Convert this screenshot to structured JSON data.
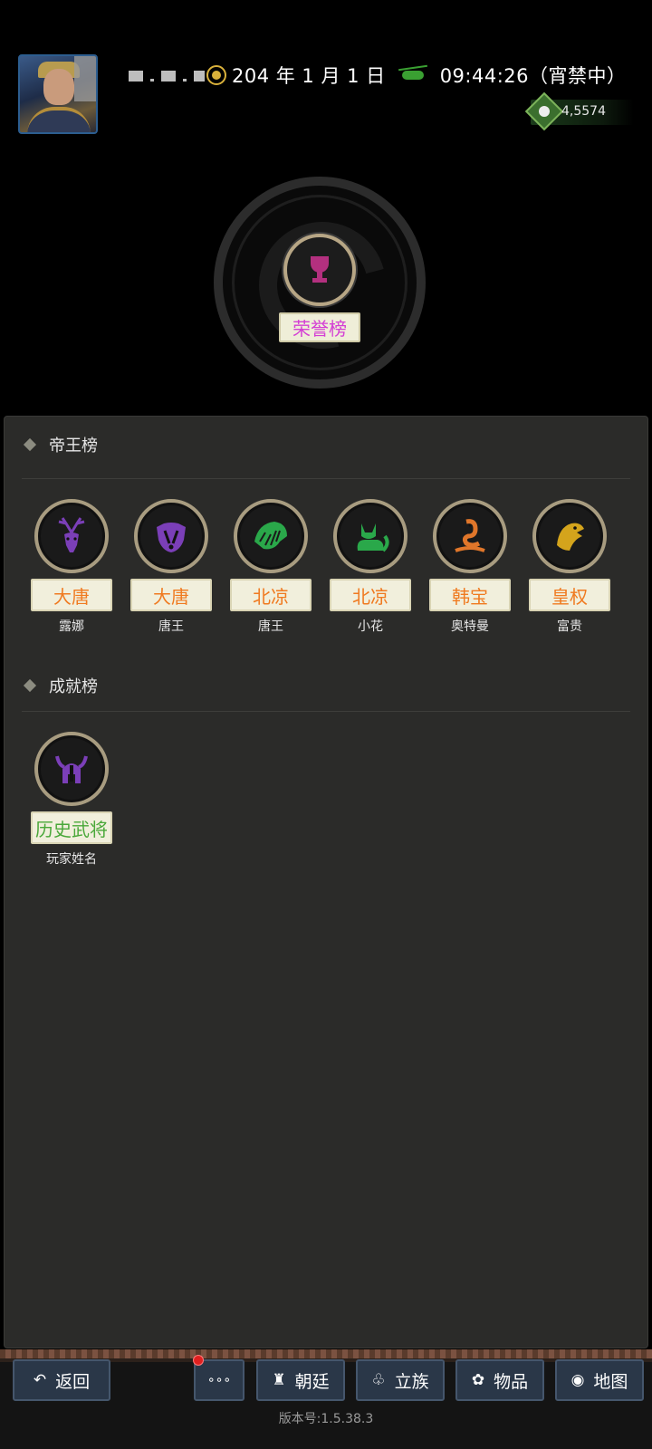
{
  "header": {
    "date": "204 年 1 月 1 日",
    "time": "09:44:26（宵禁中）",
    "currency": "4,5574"
  },
  "honor": {
    "label": "荣誉榜"
  },
  "emperor_rank": {
    "title": "帝王榜",
    "items": [
      {
        "tag": "大唐",
        "name": "露娜",
        "icon": "deer-icon",
        "icon_color": "#7b3fb8",
        "tag_color": "#f07a20"
      },
      {
        "tag": "大唐",
        "name": "唐王",
        "icon": "badger-icon",
        "icon_color": "#7b3fb8",
        "tag_color": "#f07a20"
      },
      {
        "tag": "北凉",
        "name": "唐王",
        "icon": "pangolin-icon",
        "icon_color": "#2aa84a",
        "tag_color": "#f07a20"
      },
      {
        "tag": "北凉",
        "name": "小花",
        "icon": "fox-icon",
        "icon_color": "#2aa84a",
        "tag_color": "#f07a20"
      },
      {
        "tag": "韩宝",
        "name": "奥特曼",
        "icon": "cobra-icon",
        "icon_color": "#e0762a",
        "tag_color": "#f07a20"
      },
      {
        "tag": "皇权",
        "name": "富贵",
        "icon": "eagle-icon",
        "icon_color": "#d4a41c",
        "tag_color": "#f07a20"
      }
    ]
  },
  "achievement_rank": {
    "title": "成就榜",
    "items": [
      {
        "tag": "历史武将",
        "name": "玩家姓名",
        "icon": "viking-helmet-icon",
        "icon_color": "#7b3fb8",
        "tag_color": "#4aa83a"
      }
    ]
  },
  "bottom_nav": {
    "back": "返回",
    "more": "∘∘∘",
    "court": "朝廷",
    "clan": "立族",
    "items": "物品",
    "map": "地图"
  },
  "version": "版本号:1.5.38.3"
}
